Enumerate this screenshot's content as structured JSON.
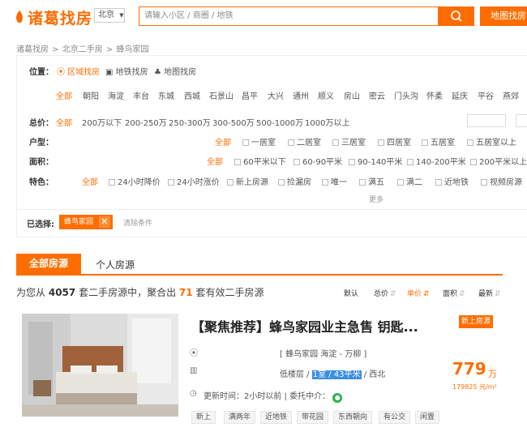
{
  "header": {
    "logo_text": "诸葛找房",
    "city": "北京",
    "search_placeholder": "请输入小区 / 商圈 / 地铁",
    "map_button": "地图找房",
    "brand_color": "#ff6d00"
  },
  "breadcrumb": [
    "诸葛找房",
    "北京二手房",
    "蜂鸟家园"
  ],
  "filter": {
    "location": {
      "label": "位置：",
      "modes": [
        "区域找房",
        "地铁找房",
        "地图找房"
      ],
      "districts": [
        "全部",
        "朝阳",
        "海淀",
        "丰台",
        "东城",
        "西城",
        "石景山",
        "昌平",
        "大兴",
        "通州",
        "顺义",
        "房山",
        "密云",
        "门头沟",
        "怀柔",
        "延庆",
        "平谷",
        "燕郊"
      ]
    },
    "price": {
      "label": "总价：",
      "options": [
        "全部",
        "200万以下",
        "200-250万",
        "250-300万",
        "300-500万",
        "500-1000万",
        "1000万以上"
      ]
    },
    "layout": {
      "label": "户型：",
      "options": [
        "全部",
        "一居室",
        "二居室",
        "三居室",
        "四居室",
        "五居室",
        "五居室以上"
      ]
    },
    "area": {
      "label": "面积：",
      "options": [
        "全部",
        "60平米以下",
        "60-90平米",
        "90-140平米",
        "140-200平米",
        "200平米以上"
      ]
    },
    "features": {
      "label": "特色：",
      "options": [
        "全部",
        "24小时降价",
        "24小时涨价",
        "新上房源",
        "捡漏房",
        "唯一",
        "满五",
        "满二",
        "近地铁",
        "视频房源"
      ]
    },
    "more": "更多",
    "selected_label": "已选择:",
    "selected_tag": "蜂鸟家园",
    "clear": "清除条件"
  },
  "tabs": [
    "全部房源",
    "个人房源"
  ],
  "summary": {
    "prefix": "为您从",
    "total": "4057",
    "mid": "套二手房源中，聚合出",
    "count": "71",
    "suffix": "套有效二手房源"
  },
  "sort": [
    "默认",
    "总价",
    "单价",
    "面积",
    "最新"
  ],
  "listing": {
    "title": "【聚焦推荐】蜂鸟家园业主急售 钥匙...",
    "badge": "新上房源",
    "address": "[ 蜂鸟家园 海淀 - 万柳 ]",
    "floor": "低楼层 / ",
    "room_highlight": "1室 / 43平米",
    "orientation": " / 西北",
    "update_prefix": "更新时间：2小时以前 | 委托中介：",
    "price": "779",
    "price_unit": "万",
    "unit_price": "179825 元/m²",
    "tags": [
      "新上",
      "满两年",
      "近地铁",
      "带花园",
      "东西朝向",
      "有公交",
      "闲置"
    ]
  }
}
